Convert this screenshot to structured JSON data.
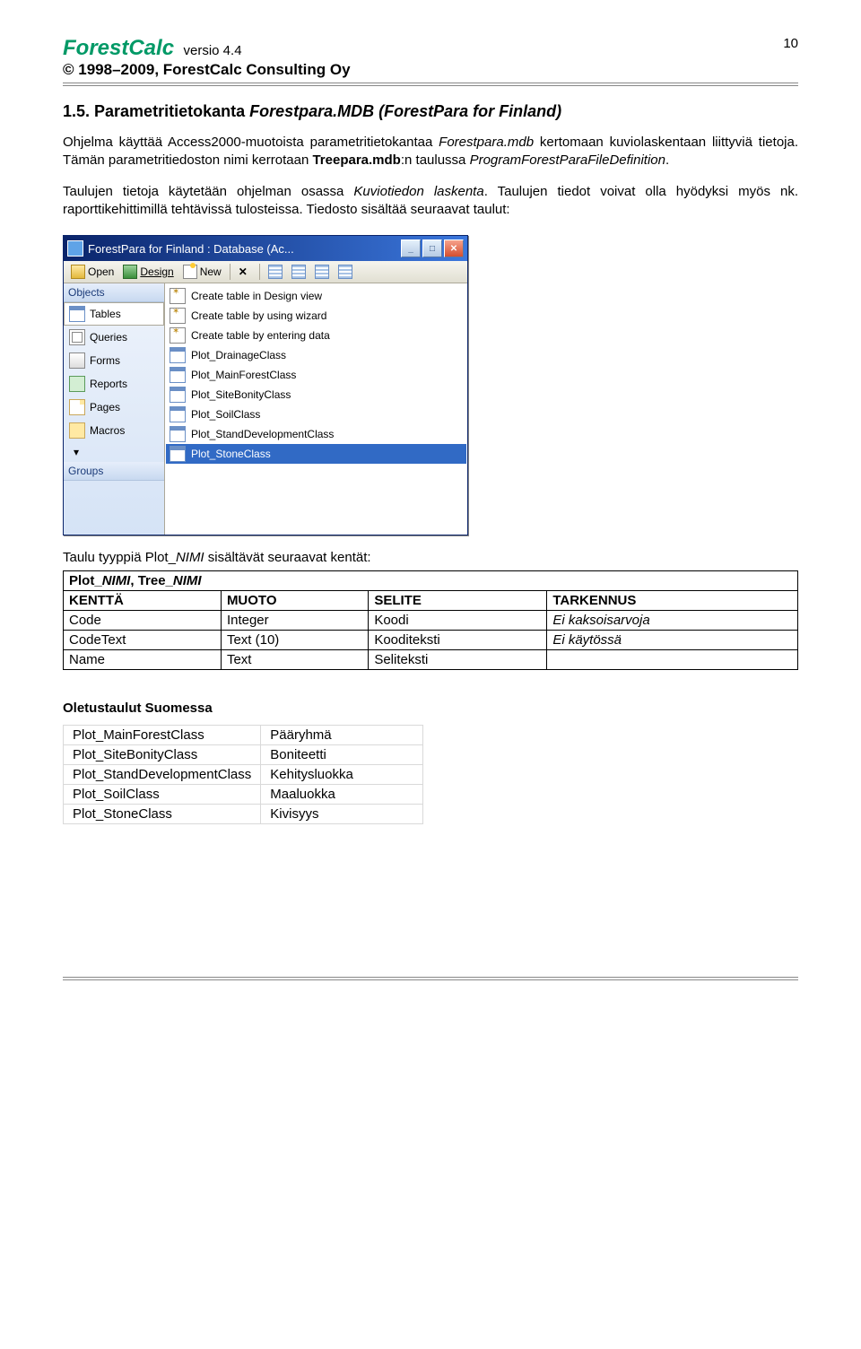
{
  "header": {
    "title": "ForestCalc",
    "version": "versio 4.4",
    "copyright": "© 1998–2009, ForestCalc Consulting Oy",
    "page_number": "10"
  },
  "section": {
    "heading_prefix": "1.5. Parametritietokanta ",
    "heading_em": "Forestpara.MDB (ForestPara for Finland)"
  },
  "para1": {
    "t1": "Ohjelma käyttää Access2000-muotoista parametritietokantaa ",
    "em1": "Forestpara.mdb",
    "t2": " kertomaan kuviolaskentaan liittyviä tietoja. Tämän parametritiedoston nimi kerrotaan ",
    "bold1": "Treepara.mdb",
    "t3": ":n taulussa ",
    "em2": "ProgramForestParaFileDefinition",
    "t4": "."
  },
  "para2": {
    "t1": "Taulujen tietoja käytetään ohjelman osassa ",
    "em1": "Kuviotiedon laskenta",
    "t2": ". Taulujen tiedot voivat olla hyödyksi myös nk. raporttikehittimillä tehtävissä tulosteissa. Tiedosto sisältää seuraavat taulut:"
  },
  "db": {
    "title": "ForestPara for Finland : Database (Ac...",
    "toolbar": {
      "open": "Open",
      "design": "Design",
      "new": "New"
    },
    "sidebar": {
      "objects": "Objects",
      "tables": "Tables",
      "queries": "Queries",
      "forms": "Forms",
      "reports": "Reports",
      "pages": "Pages",
      "macros": "Macros",
      "groups": "Groups"
    },
    "rows": {
      "create_design": "Create table in Design view",
      "create_wizard": "Create table by using wizard",
      "create_data": "Create table by entering data",
      "r1": "Plot_DrainageClass",
      "r2": "Plot_MainForestClass",
      "r3": "Plot_SiteBonityClass",
      "r4": "Plot_SoilClass",
      "r5": "Plot_StandDevelopmentClass",
      "r6": "Plot_StoneClass"
    }
  },
  "caption": {
    "t1": "Taulu tyyppiä ",
    "code1": "Plot_",
    "code2": "NIMI",
    "t2": " sisältävät seuraavat kentät:"
  },
  "schema": {
    "title_a": "Plot_",
    "title_b": "NIMI",
    "title_c": ", Tree_",
    "title_d": "NIMI",
    "h1": "KENTTÄ",
    "h2": "MUOTO",
    "h3": "SELITE",
    "h4": "TARKENNUS",
    "rows": [
      {
        "c1": "Code",
        "c2": "Integer",
        "c3": "Koodi",
        "c4": "Ei kaksoisarvoja",
        "c4_italic": true
      },
      {
        "c1": "CodeText",
        "c2": "Text (10)",
        "c3": "Kooditeksti",
        "c4": "Ei käytössä",
        "c4_italic": true
      },
      {
        "c1": "Name",
        "c2": "Text",
        "c3": "Seliteksti",
        "c4": ""
      }
    ]
  },
  "defaults": {
    "heading": "Oletustaulut Suomessa",
    "rows": [
      {
        "c1": "Plot_MainForestClass",
        "c2": "Pääryhmä"
      },
      {
        "c1": "Plot_SiteBonityClass",
        "c2": "Boniteetti"
      },
      {
        "c1": "Plot_StandDevelopmentClass",
        "c2": "Kehitysluokka"
      },
      {
        "c1": "Plot_SoilClass",
        "c2": "Maaluokka"
      },
      {
        "c1": "Plot_StoneClass",
        "c2": "Kivisyys"
      }
    ]
  }
}
